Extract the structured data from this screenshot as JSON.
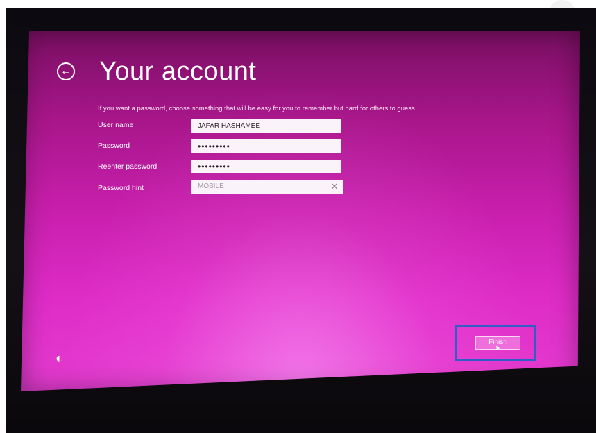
{
  "page": {
    "title": "Your account",
    "intro": "If you want a password, choose something that will be easy for you to remember but hard for others to guess."
  },
  "form": {
    "username": {
      "label": "User name",
      "value": "JAFAR HASHAMEE"
    },
    "password": {
      "label": "Password",
      "value": "•••••••••"
    },
    "reenter": {
      "label": "Reenter password",
      "value": "•••••••••"
    },
    "hint": {
      "label": "Password hint",
      "value": "MOBILE"
    }
  },
  "actions": {
    "finish_label": "Finish",
    "back_icon": "←",
    "clear_icon": "✕",
    "ease_icon": "◐"
  },
  "colors": {
    "accent": "#c81fad",
    "highlight": "#2f5ec4"
  }
}
